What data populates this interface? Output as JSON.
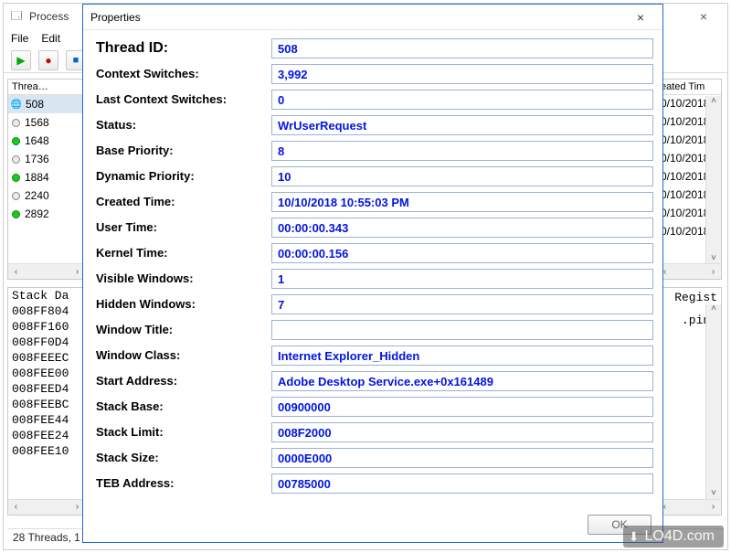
{
  "main": {
    "title": "Process",
    "menu": {
      "file": "File",
      "edit": "Edit"
    },
    "close": "×"
  },
  "thread_list": {
    "header": "Threa…",
    "rows": [
      {
        "id": "508",
        "icon": "globe",
        "selected": true
      },
      {
        "id": "1568",
        "icon": "gray"
      },
      {
        "id": "1648",
        "icon": "green"
      },
      {
        "id": "1736",
        "icon": "gray"
      },
      {
        "id": "1884",
        "icon": "green"
      },
      {
        "id": "2240",
        "icon": "gray"
      },
      {
        "id": "2892",
        "icon": "green"
      }
    ]
  },
  "right_list": {
    "header": "eated Tim",
    "rows": [
      "0/10/2018",
      "0/10/2018",
      "0/10/2018",
      "0/10/2018",
      "0/10/2018",
      "0/10/2018",
      "0/10/2018",
      "0/10/2018"
    ]
  },
  "stack": {
    "header": "Stack Da",
    "rows": [
      "008FF804",
      "008FF160",
      "008FF0D4",
      "008FEEEC",
      "008FEE00",
      "008FEED4",
      "008FEEBC",
      "008FEE44",
      "008FEE24",
      "008FEE10"
    ]
  },
  "right_detail": {
    "rows": [
      "",
      "Regist",
      "",
      "",
      "",
      "",
      ".ping",
      "",
      "",
      ""
    ]
  },
  "statusbar": "28 Threads, 1",
  "dialog": {
    "title": "Properties",
    "close": "×",
    "ok": "OK",
    "fields": {
      "thread_id": {
        "label": "Thread ID:",
        "value": "508",
        "big": true
      },
      "ctx_sw": {
        "label": "Context Switches:",
        "value": "3,992"
      },
      "last_ctx": {
        "label": "Last Context Switches:",
        "value": "0"
      },
      "status": {
        "label": "Status:",
        "value": "WrUserRequest"
      },
      "base_pri": {
        "label": "Base Priority:",
        "value": "8"
      },
      "dyn_pri": {
        "label": "Dynamic Priority:",
        "value": "10"
      },
      "created": {
        "label": "Created Time:",
        "value": "10/10/2018 10:55:03 PM"
      },
      "user_time": {
        "label": "User Time:",
        "value": "00:00:00.343"
      },
      "kernel_time": {
        "label": "Kernel Time:",
        "value": "00:00:00.156"
      },
      "vis_win": {
        "label": "Visible Windows:",
        "value": "1"
      },
      "hid_win": {
        "label": "Hidden Windows:",
        "value": "7"
      },
      "win_title": {
        "label": "Window Title:",
        "value": ""
      },
      "win_class": {
        "label": "Window Class:",
        "value": "Internet Explorer_Hidden"
      },
      "start_addr": {
        "label": "Start Address:",
        "value": "Adobe Desktop Service.exe+0x161489"
      },
      "stack_base": {
        "label": "Stack Base:",
        "value": "00900000"
      },
      "stack_limit": {
        "label": "Stack Limit:",
        "value": "008F2000"
      },
      "stack_size": {
        "label": "Stack Size:",
        "value": "0000E000"
      },
      "teb": {
        "label": "TEB Address:",
        "value": "00785000"
      }
    }
  },
  "watermark": "LO4D.com"
}
